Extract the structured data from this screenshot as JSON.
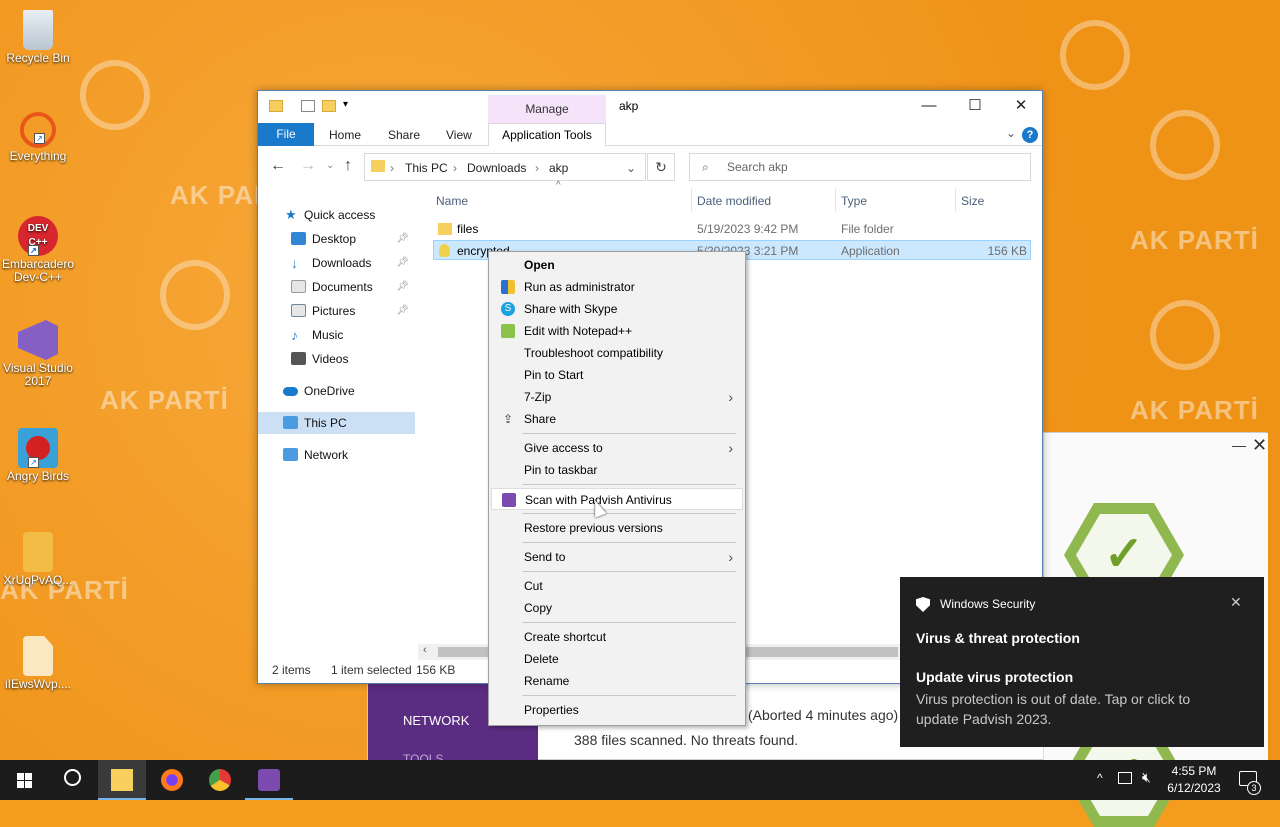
{
  "desktop": {
    "watermark": "AK PARTİ",
    "icons": [
      {
        "label": "Recycle Bin",
        "icon": "recycle-bin-icon"
      },
      {
        "label": "Everything",
        "icon": "everything-search-icon"
      },
      {
        "label": "Embarcadero Dev-C++",
        "icon": "devcpp-icon",
        "badge": "DEV C++"
      },
      {
        "label": "Visual Studio 2017",
        "icon": "visual-studio-icon"
      },
      {
        "label": "Angry Birds",
        "icon": "angry-birds-icon"
      },
      {
        "label": "XrUqPvAQ...",
        "icon": "file-icon"
      },
      {
        "label": "iIEwsWvp....",
        "icon": "file-icon"
      }
    ]
  },
  "explorer": {
    "title": "akp",
    "manage_label": "Manage",
    "tabs": {
      "file": "File",
      "home": "Home",
      "share": "Share",
      "view": "View",
      "app_tools": "Application Tools"
    },
    "help": "?",
    "breadcrumb": [
      "This PC",
      "Downloads",
      "akp"
    ],
    "search_placeholder": "Search akp",
    "nav": {
      "quick_access": "Quick access",
      "desktop": "Desktop",
      "downloads": "Downloads",
      "documents": "Documents",
      "pictures": "Pictures",
      "music": "Music",
      "videos": "Videos",
      "onedrive": "OneDrive",
      "this_pc": "This PC",
      "network": "Network"
    },
    "columns": {
      "name": "Name",
      "date": "Date modified",
      "type": "Type",
      "size": "Size"
    },
    "rows": [
      {
        "name": "files",
        "date": "5/19/2023 9:42 PM",
        "type": "File folder",
        "size": ""
      },
      {
        "name": "encrypted",
        "date": "5/20/2023 3:21 PM",
        "type": "Application",
        "size": "156 KB"
      }
    ],
    "status": {
      "items": "2 items",
      "selected": "1 item selected",
      "size": "156 KB"
    }
  },
  "context_menu": {
    "open": "Open",
    "run_admin": "Run as administrator",
    "skype": "Share with Skype",
    "notepad": "Edit with Notepad++",
    "troubleshoot": "Troubleshoot compatibility",
    "pin_start": "Pin to Start",
    "zip": "7-Zip",
    "share": "Share",
    "give_access": "Give access to",
    "pin_taskbar": "Pin to taskbar",
    "scan": "Scan with Padvish Antivirus",
    "restore": "Restore previous versions",
    "send_to": "Send to",
    "cut": "Cut",
    "copy": "Copy",
    "create_shortcut": "Create shortcut",
    "delete": "Delete",
    "rename": "Rename",
    "properties": "Properties"
  },
  "padvish": {
    "network": "NETWORK",
    "tools": "TOOLS",
    "aborted": "(Aborted 4 minutes ago)",
    "scanned": "388 files scanned. No threats found."
  },
  "toast": {
    "app": "Windows Security",
    "title": "Virus & threat protection",
    "heading": "Update virus protection",
    "body": "Virus protection is out of date. Tap or click to update Padvish 2023."
  },
  "taskbar": {
    "time": "4:55 PM",
    "date": "6/12/2023",
    "notifications": "3"
  },
  "colors": {
    "desktop": "#f39c1e",
    "accent": "#1979ca",
    "padvish": "#5b2d82",
    "selection": "#cce8ff"
  }
}
